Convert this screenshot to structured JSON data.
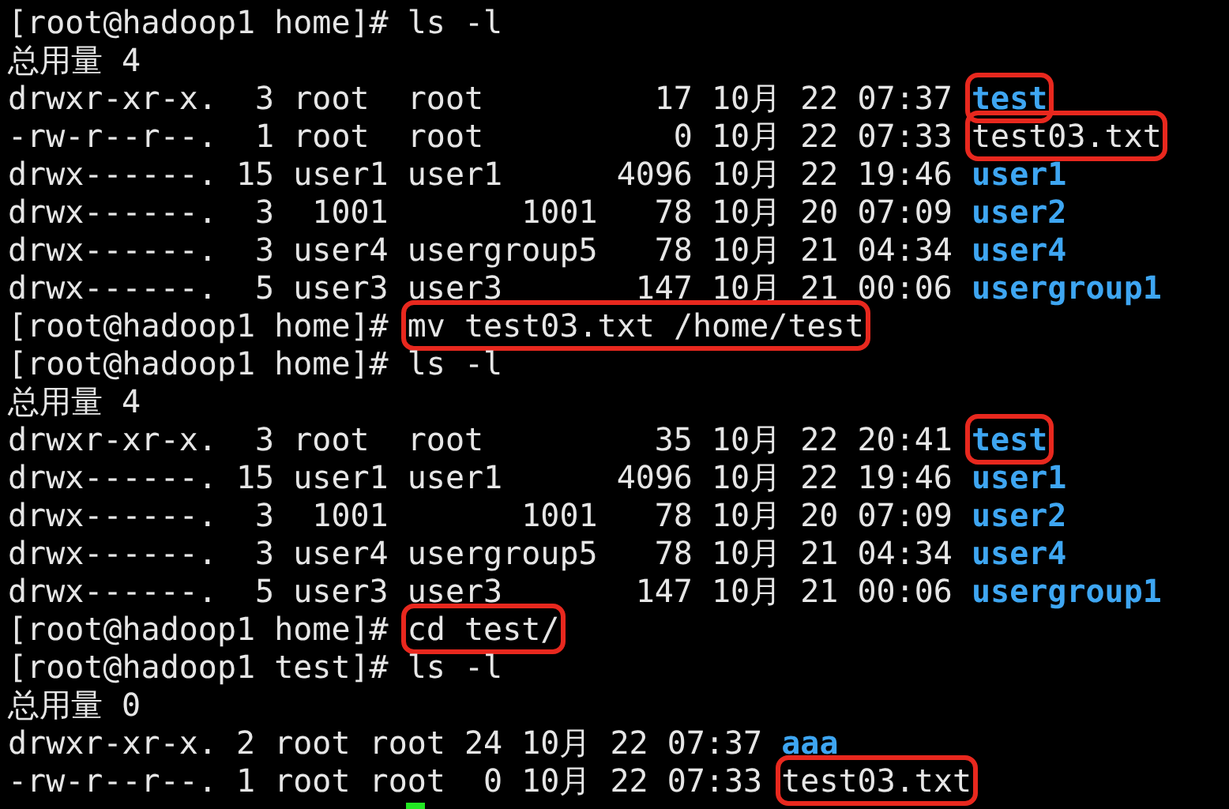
{
  "terminal": {
    "lines": [
      {
        "segments": [
          {
            "kind": "plain",
            "text": "[root@hadoop1 home]# ls -l",
            "boxed": false
          }
        ]
      },
      {
        "segments": [
          {
            "kind": "plain",
            "text": "总用量 4",
            "boxed": false
          }
        ]
      },
      {
        "segments": [
          {
            "kind": "plain",
            "text": "drwxr-xr-x.  3 root  root         17 10月 22 07:37 ",
            "boxed": false
          },
          {
            "kind": "directory",
            "text": "test",
            "boxed": true
          }
        ]
      },
      {
        "segments": [
          {
            "kind": "plain",
            "text": "-rw-r--r--.  1 root  root          0 10月 22 07:33 ",
            "boxed": false
          },
          {
            "kind": "file",
            "text": "test03.txt",
            "boxed": true
          }
        ]
      },
      {
        "segments": [
          {
            "kind": "plain",
            "text": "drwx------. 15 user1 user1      4096 10月 22 19:46 ",
            "boxed": false
          },
          {
            "kind": "directory",
            "text": "user1",
            "boxed": false
          }
        ]
      },
      {
        "segments": [
          {
            "kind": "plain",
            "text": "drwx------.  3  1001       1001   78 10月 20 07:09 ",
            "boxed": false
          },
          {
            "kind": "directory",
            "text": "user2",
            "boxed": false
          }
        ]
      },
      {
        "segments": [
          {
            "kind": "plain",
            "text": "drwx------.  3 user4 usergroup5   78 10月 21 04:34 ",
            "boxed": false
          },
          {
            "kind": "directory",
            "text": "user4",
            "boxed": false
          }
        ]
      },
      {
        "segments": [
          {
            "kind": "plain",
            "text": "drwx------.  5 user3 user3       147 10月 21 00:06 ",
            "boxed": false
          },
          {
            "kind": "directory",
            "text": "usergroup1",
            "boxed": false
          }
        ]
      },
      {
        "segments": [
          {
            "kind": "plain",
            "text": "[root@hadoop1 home]# ",
            "boxed": false
          },
          {
            "kind": "command",
            "text": "mv test03.txt /home/test",
            "boxed": true
          }
        ]
      },
      {
        "segments": [
          {
            "kind": "plain",
            "text": "[root@hadoop1 home]# ls -l",
            "boxed": false
          }
        ]
      },
      {
        "segments": [
          {
            "kind": "plain",
            "text": "总用量 4",
            "boxed": false
          }
        ]
      },
      {
        "segments": [
          {
            "kind": "plain",
            "text": "drwxr-xr-x.  3 root  root         35 10月 22 20:41 ",
            "boxed": false
          },
          {
            "kind": "directory",
            "text": "test",
            "boxed": true
          }
        ]
      },
      {
        "segments": [
          {
            "kind": "plain",
            "text": "drwx------. 15 user1 user1      4096 10月 22 19:46 ",
            "boxed": false
          },
          {
            "kind": "directory",
            "text": "user1",
            "boxed": false
          }
        ]
      },
      {
        "segments": [
          {
            "kind": "plain",
            "text": "drwx------.  3  1001       1001   78 10月 20 07:09 ",
            "boxed": false
          },
          {
            "kind": "directory",
            "text": "user2",
            "boxed": false
          }
        ]
      },
      {
        "segments": [
          {
            "kind": "plain",
            "text": "drwx------.  3 user4 usergroup5   78 10月 21 04:34 ",
            "boxed": false
          },
          {
            "kind": "directory",
            "text": "user4",
            "boxed": false
          }
        ]
      },
      {
        "segments": [
          {
            "kind": "plain",
            "text": "drwx------.  5 user3 user3       147 10月 21 00:06 ",
            "boxed": false
          },
          {
            "kind": "directory",
            "text": "usergroup1",
            "boxed": false
          }
        ]
      },
      {
        "segments": [
          {
            "kind": "plain",
            "text": "[root@hadoop1 home]# ",
            "boxed": false
          },
          {
            "kind": "command",
            "text": "cd test/",
            "boxed": true
          }
        ]
      },
      {
        "segments": [
          {
            "kind": "plain",
            "text": "[root@hadoop1 test]# ls -l",
            "boxed": false
          }
        ]
      },
      {
        "segments": [
          {
            "kind": "plain",
            "text": "总用量 0",
            "boxed": false
          }
        ]
      },
      {
        "segments": [
          {
            "kind": "plain",
            "text": "drwxr-xr-x. 2 root root 24 10月 22 07:37 ",
            "boxed": false
          },
          {
            "kind": "directory",
            "text": "aaa",
            "boxed": false
          }
        ]
      },
      {
        "segments": [
          {
            "kind": "plain",
            "text": "-rw-r--r--. 1 root root  0 10月 22 07:33 ",
            "boxed": false
          },
          {
            "kind": "file",
            "text": "test03.txt",
            "boxed": true
          }
        ]
      }
    ]
  }
}
